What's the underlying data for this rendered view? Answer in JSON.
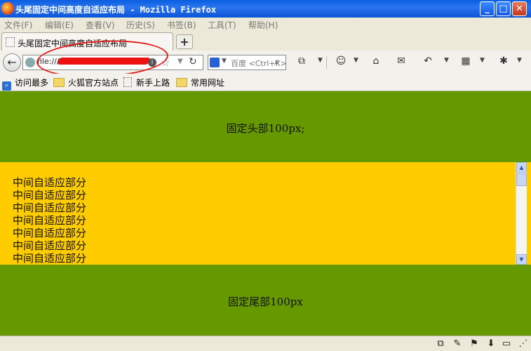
{
  "window": {
    "title": "头尾固定中间高度自适应布局 - Mozilla Firefox",
    "buttons": {
      "minimize": "_",
      "maximize": "□",
      "close": "✕"
    }
  },
  "menu": [
    "文件(F)",
    "编辑(E)",
    "查看(V)",
    "历史(S)",
    "书签(B)",
    "工具(T)",
    "帮助(H)"
  ],
  "tabs": [
    {
      "title": "头尾固定中间高度自适应布局"
    }
  ],
  "new_tab_label": "+",
  "nav": {
    "back": "←",
    "url": "file:///",
    "search_placeholder": "百度 <Ctrl+K>",
    "reload": "↻",
    "star": "☆"
  },
  "bookmarks": [
    "访问最多",
    "火狐官方站点",
    "新手上路",
    "常用网址"
  ],
  "content": {
    "header_text": "固定头部100px;",
    "middle_lines": [
      "中间自适应部分",
      "中间自适应部分",
      "中间自适应部分",
      "中间自适应部分",
      "中间自适应部分",
      "中间自适应部分",
      "中间自适应部分"
    ],
    "footer_text": "固定尾部100px"
  },
  "colors": {
    "header_footer_bg": "#669900",
    "middle_bg": "#ffcc00"
  },
  "icons": [
    "firefox-logo-icon",
    "globe-icon",
    "star-icon",
    "reload-icon",
    "search-icon",
    "home-icon",
    "mail-icon",
    "undo-icon",
    "folder-icon"
  ]
}
